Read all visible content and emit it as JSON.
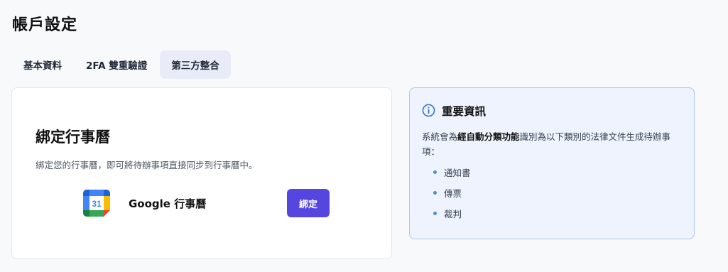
{
  "page": {
    "title": "帳戶設定"
  },
  "tabs": [
    {
      "label": "基本資料",
      "active": false
    },
    {
      "label": "2FA 雙重驗證",
      "active": false
    },
    {
      "label": "第三方整合",
      "active": true
    }
  ],
  "integration": {
    "title": "綁定行事曆",
    "description": "綁定您的行事曆，即可將待辦事項直接同步到行事曆中。",
    "provider_label": "Google 行事曆",
    "provider_icon": "google-calendar-icon",
    "calendar_day": "31",
    "bind_label": "綁定",
    "accent_color": "#5546e0"
  },
  "info": {
    "title": "重要資訊",
    "text_before": "系統會為",
    "text_bold": "經自動分類功能",
    "text_after": "識別為以下類別的法律文件生成待辦事項：",
    "items": [
      "通知書",
      "傳票",
      "裁判"
    ]
  }
}
